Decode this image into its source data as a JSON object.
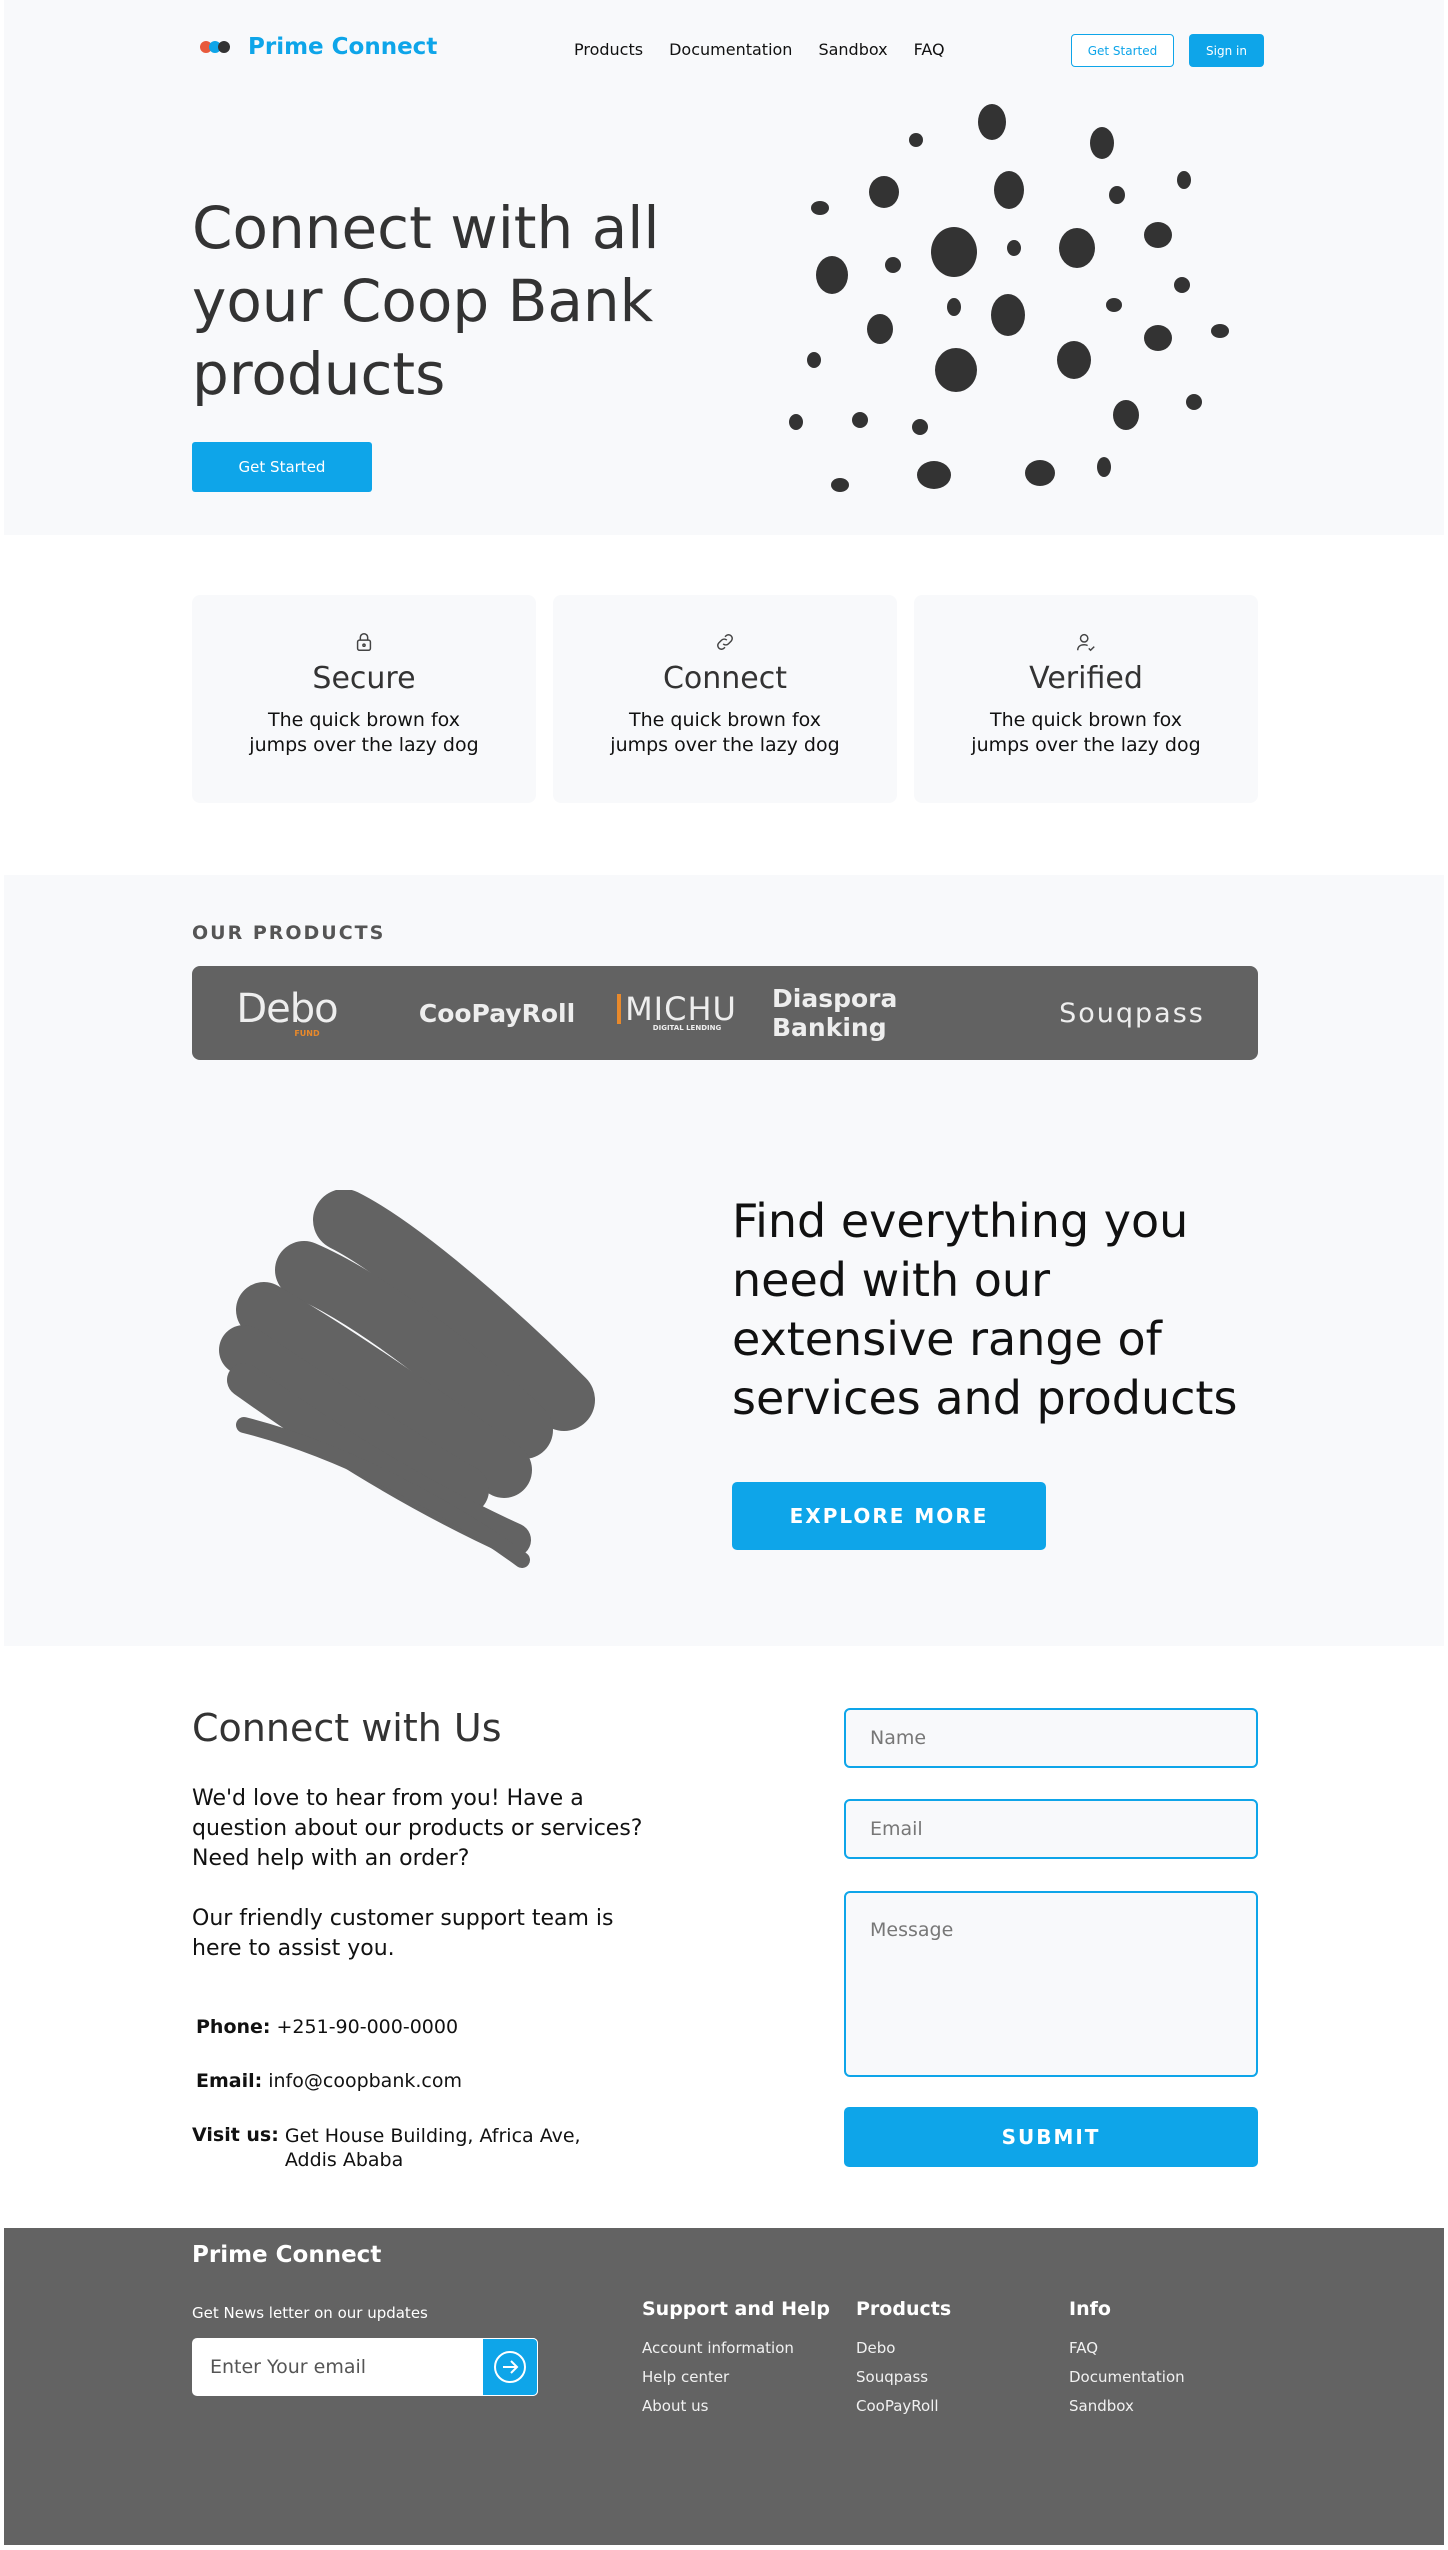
{
  "header": {
    "brand": "Prime Connect",
    "nav": [
      "Products",
      "Documentation",
      "Sandbox",
      "FAQ"
    ],
    "get_started": "Get Started",
    "sign_in": "Sign in"
  },
  "hero": {
    "title": "Connect with all your Coop Bank products",
    "cta": "Get Started"
  },
  "features": [
    {
      "icon": "lock-icon",
      "title": "Secure",
      "text": "The quick brown fox jumps over the lazy dog"
    },
    {
      "icon": "link-icon",
      "title": "Connect",
      "text": "The quick brown fox jumps over the lazy dog"
    },
    {
      "icon": "user-check-icon",
      "title": "Verified",
      "text": "The quick brown fox jumps over the lazy dog"
    }
  ],
  "products": {
    "label": "OUR PRODUCTS",
    "items": [
      "Debo",
      "CooPayRoll",
      "MICHU",
      "Diaspora Banking",
      "Souqpass"
    ],
    "debo_sub": "FUND",
    "michu_sub": "DIGITAL LENDING"
  },
  "explore": {
    "title": "Find everything you need with our extensive range of services and products",
    "cta": "EXPLORE MORE"
  },
  "contact": {
    "title": "Connect with Us",
    "para1": "We'd love to hear from you! Have a question about our products or services? Need help with an order?",
    "para2": "Our friendly customer support team is here to assist you.",
    "phone_label": "Phone:",
    "phone": "+251-90-000-0000",
    "email_label": "Email:",
    "email": "info@coopbank.com",
    "visit_label": "Visit us:",
    "address": "Get House Building, Africa Ave, Addis Ababa",
    "name_placeholder": "Name",
    "email_placeholder": "Email",
    "message_placeholder": "Message",
    "submit": "SUBMIT"
  },
  "footer": {
    "brand": "Prime Connect",
    "newsletter": "Get News letter on our updates",
    "newsletter_placeholder": "Enter Your email",
    "columns": [
      {
        "title": "Support and Help",
        "links": [
          "Account information",
          "Help center",
          "About us"
        ]
      },
      {
        "title": "Products",
        "links": [
          "Debo",
          "Souqpass",
          "CooPayRoll"
        ]
      },
      {
        "title": "Info",
        "links": [
          "FAQ",
          "Documentation",
          "Sandbox"
        ]
      }
    ]
  },
  "colors": {
    "accent": "#0ea5e9",
    "dark": "#636363",
    "blob": "#333333"
  }
}
